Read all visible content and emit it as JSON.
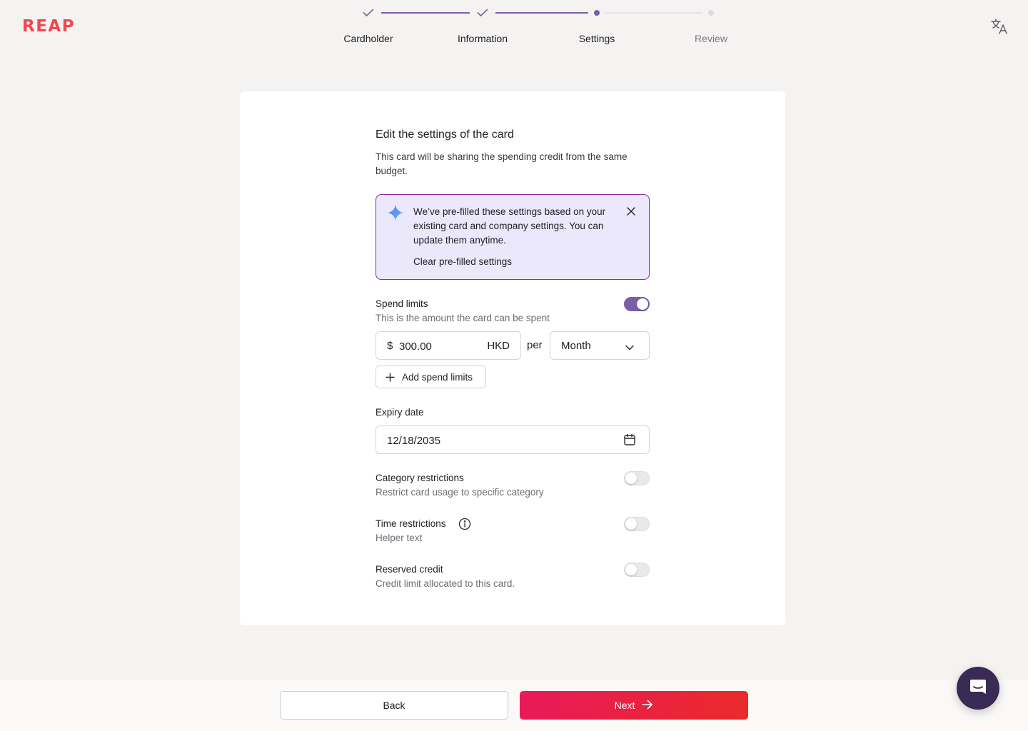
{
  "brand": {
    "logo_text": "REAP",
    "color": "#f2474f"
  },
  "stepper": {
    "steps": [
      {
        "label": "Cardholder",
        "state": "complete"
      },
      {
        "label": "Information",
        "state": "complete"
      },
      {
        "label": "Settings",
        "state": "current"
      },
      {
        "label": "Review",
        "state": "upcoming"
      }
    ],
    "accent": "#7a5fa8"
  },
  "header": {
    "language_icon": "translate-icon"
  },
  "form": {
    "title": "Edit the settings of the card",
    "subtitle": "This card will be sharing the spending credit from the same budget.",
    "notice": {
      "icon": "sparkle-icon",
      "message": "We’ve pre-filled these settings based on your existing card and company settings. You can update them anytime.",
      "action": "Clear pre-filled settings"
    },
    "spend_limits": {
      "label": "Spend limits",
      "help": "This is the amount the card can be spent",
      "enabled": true,
      "currency_symbol": "$",
      "amount": "300.00",
      "currency_code": "HKD",
      "per_label": "per",
      "period": "Month",
      "add_label": "Add spend limits"
    },
    "expiry": {
      "label": "Expiry date",
      "value": "12/18/2035"
    },
    "category_restrictions": {
      "label": "Category restrictions",
      "help": "Restrict card usage to specific category",
      "enabled": false
    },
    "time_restrictions": {
      "label": "Time restrictions",
      "help": "Helper text",
      "enabled": false
    },
    "reserved_credit": {
      "label": "Reserved credit",
      "help": "Credit limit allocated to this card.",
      "enabled": false
    }
  },
  "footer": {
    "back_label": "Back",
    "next_label": "Next"
  }
}
